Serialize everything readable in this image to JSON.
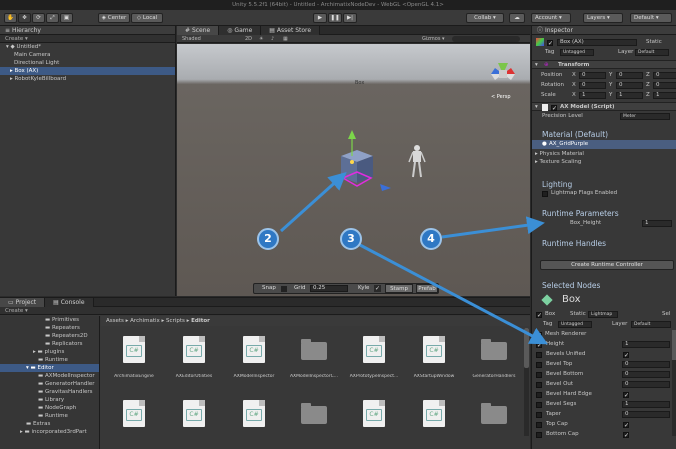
{
  "window_title": "Unity 5.5.2f1 (64bit) - Untitled - ArchimatixNodeDev - WebGL <OpenGL 4.1>",
  "toolbar": {
    "center": "Center",
    "local": "Local",
    "collab": "Collab ▾",
    "account": "Account",
    "layers": "Layers",
    "layout": "Default"
  },
  "hierarchy": {
    "title": "Hierarchy",
    "create": "Create ▾",
    "scene_name": "Untitled*",
    "items": [
      "Main Camera",
      "Directional Light",
      "Box (AX)",
      "RobotKyleBillboard"
    ]
  },
  "scene_view": {
    "tabs": [
      "Scene",
      "Game",
      "Asset Store"
    ],
    "shaded": "Shaded",
    "mode_2d": "2D",
    "gizmos": "Gizmos ▾",
    "persp": "< Persp",
    "object_label": "Box",
    "bottom": {
      "snap": "Snap",
      "grid": "Grid",
      "grid_value": "0.25",
      "kyle": "Kyle",
      "stamp": "Stamp",
      "prefab": "Prefab"
    },
    "callouts": [
      "2",
      "3",
      "4"
    ]
  },
  "project": {
    "tabs": [
      "Project",
      "Console"
    ],
    "create": "Create ▾",
    "breadcrumb": [
      "Assets",
      "Archimatix",
      "Scripts",
      "Editor"
    ],
    "tree": [
      "Primitives",
      "Repeaters",
      "Repeaters2D",
      "Replicators",
      "plugins",
      "Runtime",
      "Editor",
      "AXModelInspector",
      "GeneratorHandler",
      "GravitasHandlers",
      "Library",
      "NodeGraph",
      "Runtime",
      "Extras",
      "incorporated3rdPart"
    ],
    "files": [
      {
        "name": "ArchimatixEngine",
        "kind": "cs"
      },
      {
        "name": "AXEditorUtilities",
        "kind": "cs"
      },
      {
        "name": "AXModelInspector",
        "kind": "cs"
      },
      {
        "name": "AXModelInspectorC...",
        "kind": "folder"
      },
      {
        "name": "AXPrototypeInspect...",
        "kind": "cs"
      },
      {
        "name": "AXStartupWindow",
        "kind": "cs"
      },
      {
        "name": "GeneratorHandlers",
        "kind": "folder"
      },
      {
        "name": "",
        "kind": "cs"
      },
      {
        "name": "",
        "kind": "cs"
      },
      {
        "name": "",
        "kind": "cs"
      },
      {
        "name": "",
        "kind": "folder"
      },
      {
        "name": "",
        "kind": "cs"
      },
      {
        "name": "",
        "kind": "cs"
      },
      {
        "name": "",
        "kind": "folder"
      }
    ]
  },
  "inspector": {
    "title": "Inspector",
    "object_name": "Box (AX)",
    "static": "Static",
    "tag_label": "Tag",
    "tag_value": "Untagged",
    "layer_label": "Layer",
    "layer_value": "Default",
    "transform": {
      "title": "Transform",
      "rows": [
        {
          "label": "Position",
          "x": "0",
          "y": "0",
          "z": "0"
        },
        {
          "label": "Rotation",
          "x": "0",
          "y": "0",
          "z": "0"
        },
        {
          "label": "Scale",
          "x": "1",
          "y": "1",
          "z": "1"
        }
      ]
    },
    "ax_model": {
      "title": "AX Model (Script)",
      "precision_label": "Precision Level",
      "precision_value": "Meter"
    },
    "material_heading": "Material (Default)",
    "material_value": "AX_GridPurple",
    "foldouts": [
      "Physics Material",
      "Texture Scaling"
    ],
    "lighting_heading": "Lighting",
    "lightmap_label": "Lightmap Flags Enabled",
    "runtime_params_heading": "Runtime Parameters",
    "box_height_label": "Box_Height",
    "box_height_value": "1",
    "runtime_handles_heading": "Runtime Handles",
    "create_controller": "Create Runtime Controller",
    "selected_nodes_heading": "Selected Nodes",
    "node_name": "Box",
    "node_static": "Static",
    "node_static_value": "Lightmap",
    "sel_label": "Sel",
    "node_tag_value": "Untagged",
    "node_layer_value": "Default",
    "mesh_renderer": "Mesh Renderer",
    "props": [
      {
        "label": "Height",
        "value": "1"
      },
      {
        "label": "Bevels Unified",
        "value": ""
      },
      {
        "label": "Bevel Top",
        "value": "0"
      },
      {
        "label": "Bevel Bottom",
        "value": "0"
      },
      {
        "label": "Bevel Out",
        "value": "0"
      },
      {
        "label": "Bevel Hard Edge",
        "value": ""
      },
      {
        "label": "Bevel Segs",
        "value": "1"
      },
      {
        "label": "Taper",
        "value": "0"
      },
      {
        "label": "Top Cap",
        "value": ""
      },
      {
        "label": "Bottom Cap",
        "value": ""
      }
    ]
  },
  "colors": {
    "accent": "#3d5a86",
    "callout": "#2f78c4",
    "arrow": "#3b8fd6"
  }
}
